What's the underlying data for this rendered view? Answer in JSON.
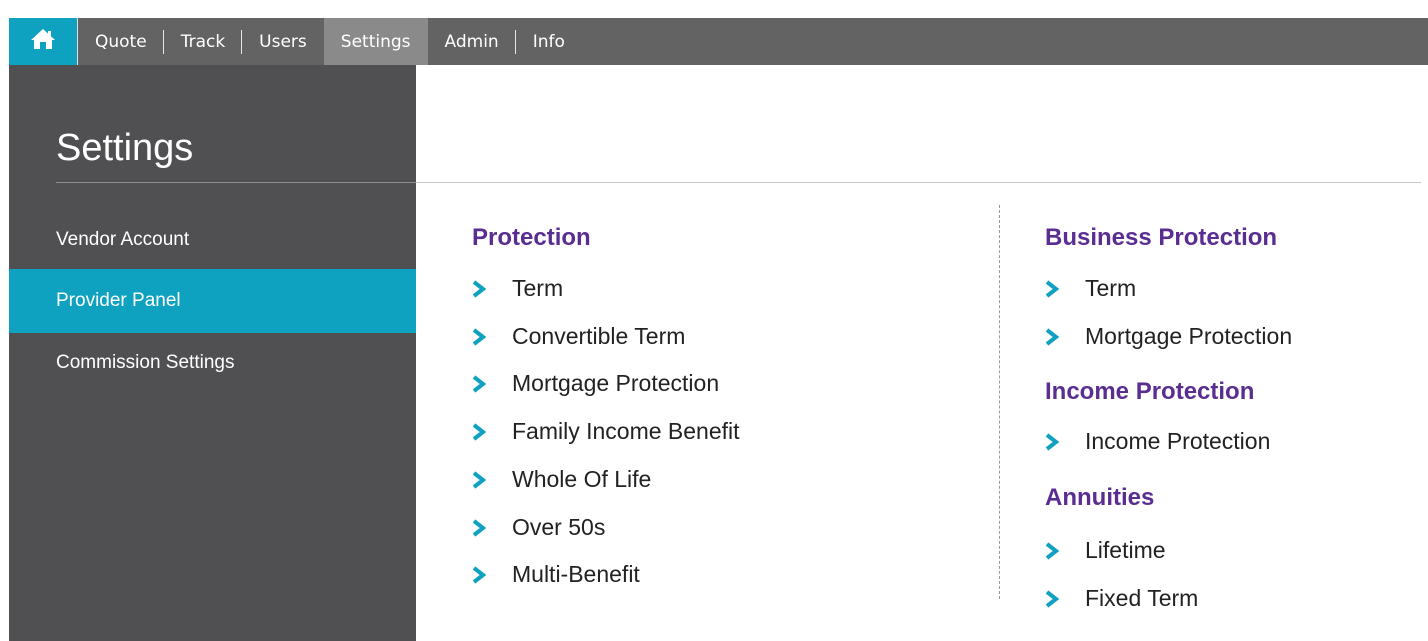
{
  "nav": {
    "home_icon": "home-icon",
    "items": [
      {
        "label": "Quote"
      },
      {
        "label": "Track"
      },
      {
        "label": "Users"
      },
      {
        "label": "Settings"
      },
      {
        "label": "Admin"
      },
      {
        "label": "Info"
      }
    ],
    "active": "Settings"
  },
  "sidebar": {
    "title": "Settings",
    "items": [
      {
        "label": "Vendor Account"
      },
      {
        "label": "Provider Panel"
      },
      {
        "label": "Commission Settings"
      }
    ],
    "active": "Provider Panel"
  },
  "main": {
    "protection": {
      "heading": "Protection",
      "links": [
        "Term",
        "Convertible Term",
        "Mortgage Protection",
        "Family Income Benefit",
        "Whole Of Life",
        "Over 50s",
        "Multi-Benefit"
      ]
    },
    "business_protection": {
      "heading": "Business Protection",
      "links": [
        "Term",
        "Mortgage Protection"
      ]
    },
    "income_protection": {
      "heading": "Income Protection",
      "links": [
        "Income Protection"
      ]
    },
    "annuities": {
      "heading": "Annuities",
      "links": [
        "Lifetime",
        "Fixed Term"
      ]
    }
  },
  "colors": {
    "accent": "#0ea2c0",
    "heading": "#5a2d91",
    "topbar": "#636363",
    "sidebar": "#505053"
  },
  "icons": {
    "link_marker": "chevron-right-icon"
  }
}
